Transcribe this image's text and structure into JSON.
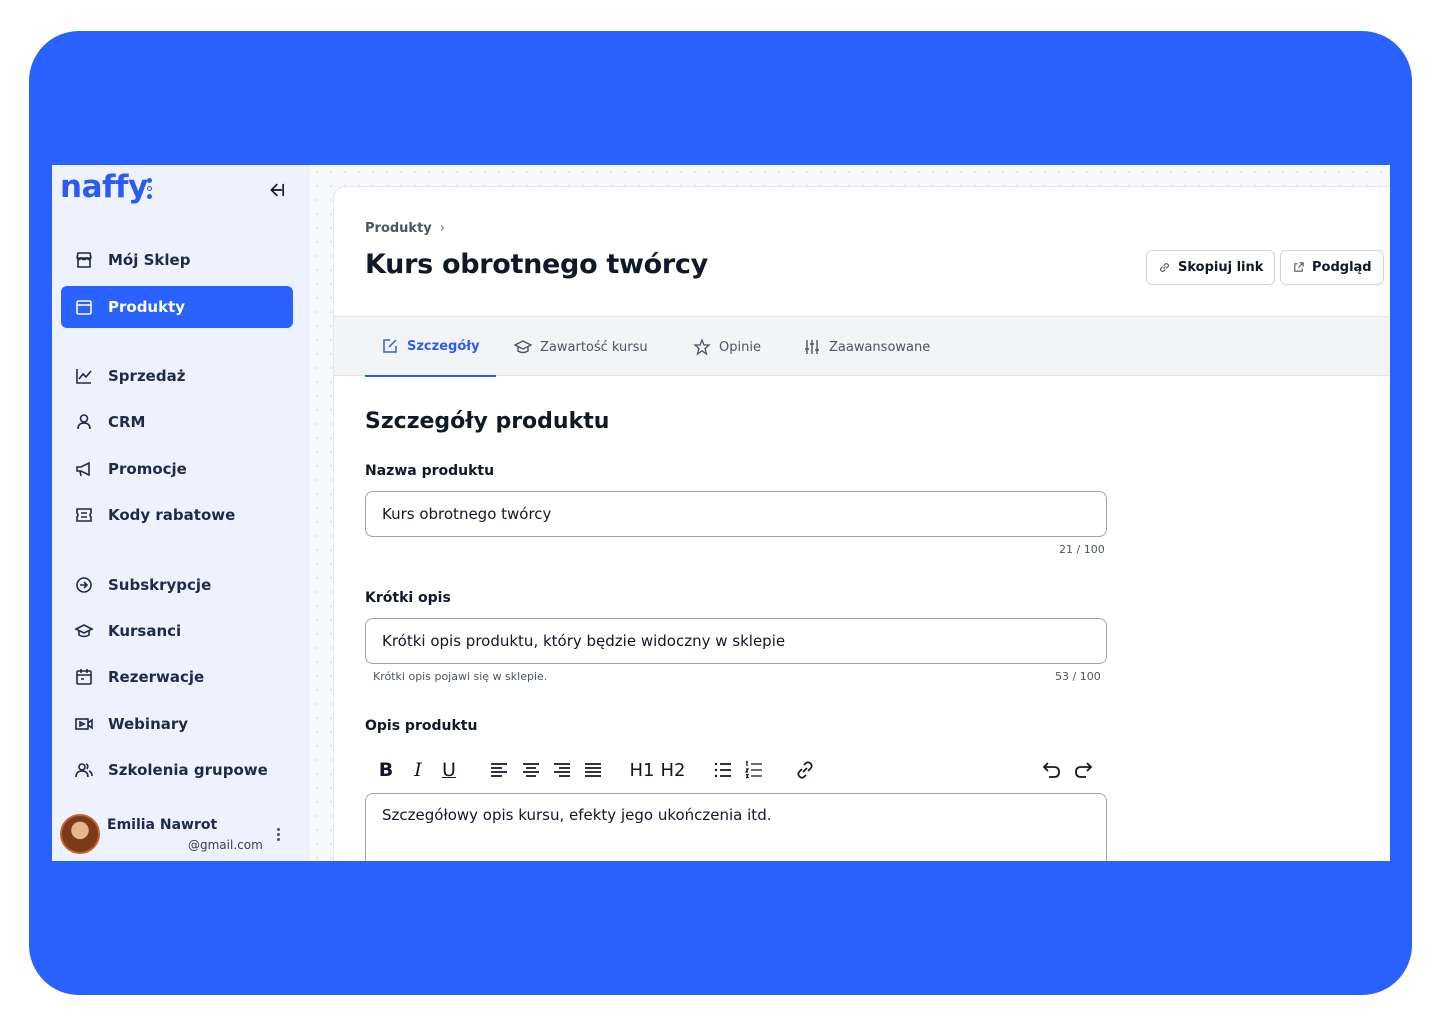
{
  "brand": {
    "logo": "naffy",
    "accent": "#2962ff"
  },
  "sidebar": {
    "items": [
      {
        "label": "Mój Sklep",
        "icon": "store-icon",
        "active": false
      },
      {
        "label": "Produkty",
        "icon": "box-icon",
        "active": true
      },
      {
        "label": "Sprzedaż",
        "icon": "chart-icon",
        "active": false
      },
      {
        "label": "CRM",
        "icon": "user-icon",
        "active": false
      },
      {
        "label": "Promocje",
        "icon": "megaphone-icon",
        "active": false
      },
      {
        "label": "Kody rabatowe",
        "icon": "ticket-icon",
        "active": false
      },
      {
        "label": "Subskrypcje",
        "icon": "subscription-icon",
        "active": false
      },
      {
        "label": "Kursanci",
        "icon": "graduation-cap-icon",
        "active": false
      },
      {
        "label": "Rezerwacje",
        "icon": "calendar-icon",
        "active": false
      },
      {
        "label": "Webinary",
        "icon": "video-icon",
        "active": false
      },
      {
        "label": "Szkolenia grupowe",
        "icon": "users-icon",
        "active": false
      }
    ],
    "user": {
      "name": "Emilia Nawrot",
      "email": "@gmail.com"
    }
  },
  "header": {
    "breadcrumb": "Produkty",
    "title": "Kurs obrotnego twórcy",
    "copy_link": "Skopiuj link",
    "preview": "Podgląd"
  },
  "tabs": [
    {
      "label": "Szczegóły",
      "icon": "edit-icon",
      "active": true
    },
    {
      "label": "Zawartość kursu",
      "icon": "graduation-cap-icon",
      "active": false
    },
    {
      "label": "Opinie",
      "icon": "star-icon",
      "active": false
    },
    {
      "label": "Zaawansowane",
      "icon": "sliders-icon",
      "active": false
    }
  ],
  "form": {
    "section_title": "Szczegóły produktu",
    "name": {
      "label": "Nazwa produktu",
      "value": "Kurs obrotnego twórcy",
      "counter": "21 / 100"
    },
    "short_desc": {
      "label": "Krótki opis",
      "value": "Krótki opis produktu, który będzie widoczny w sklepie",
      "hint": "Krótki opis pojawi się w sklepie.",
      "counter": "53 / 100"
    },
    "description": {
      "label": "Opis produktu",
      "value": "Szczegółowy opis kursu, efekty jego ukończenia itd."
    }
  },
  "toolbar": {
    "bold": "B",
    "italic": "I",
    "underline": "U",
    "h1": "H1",
    "h2": "H2"
  }
}
